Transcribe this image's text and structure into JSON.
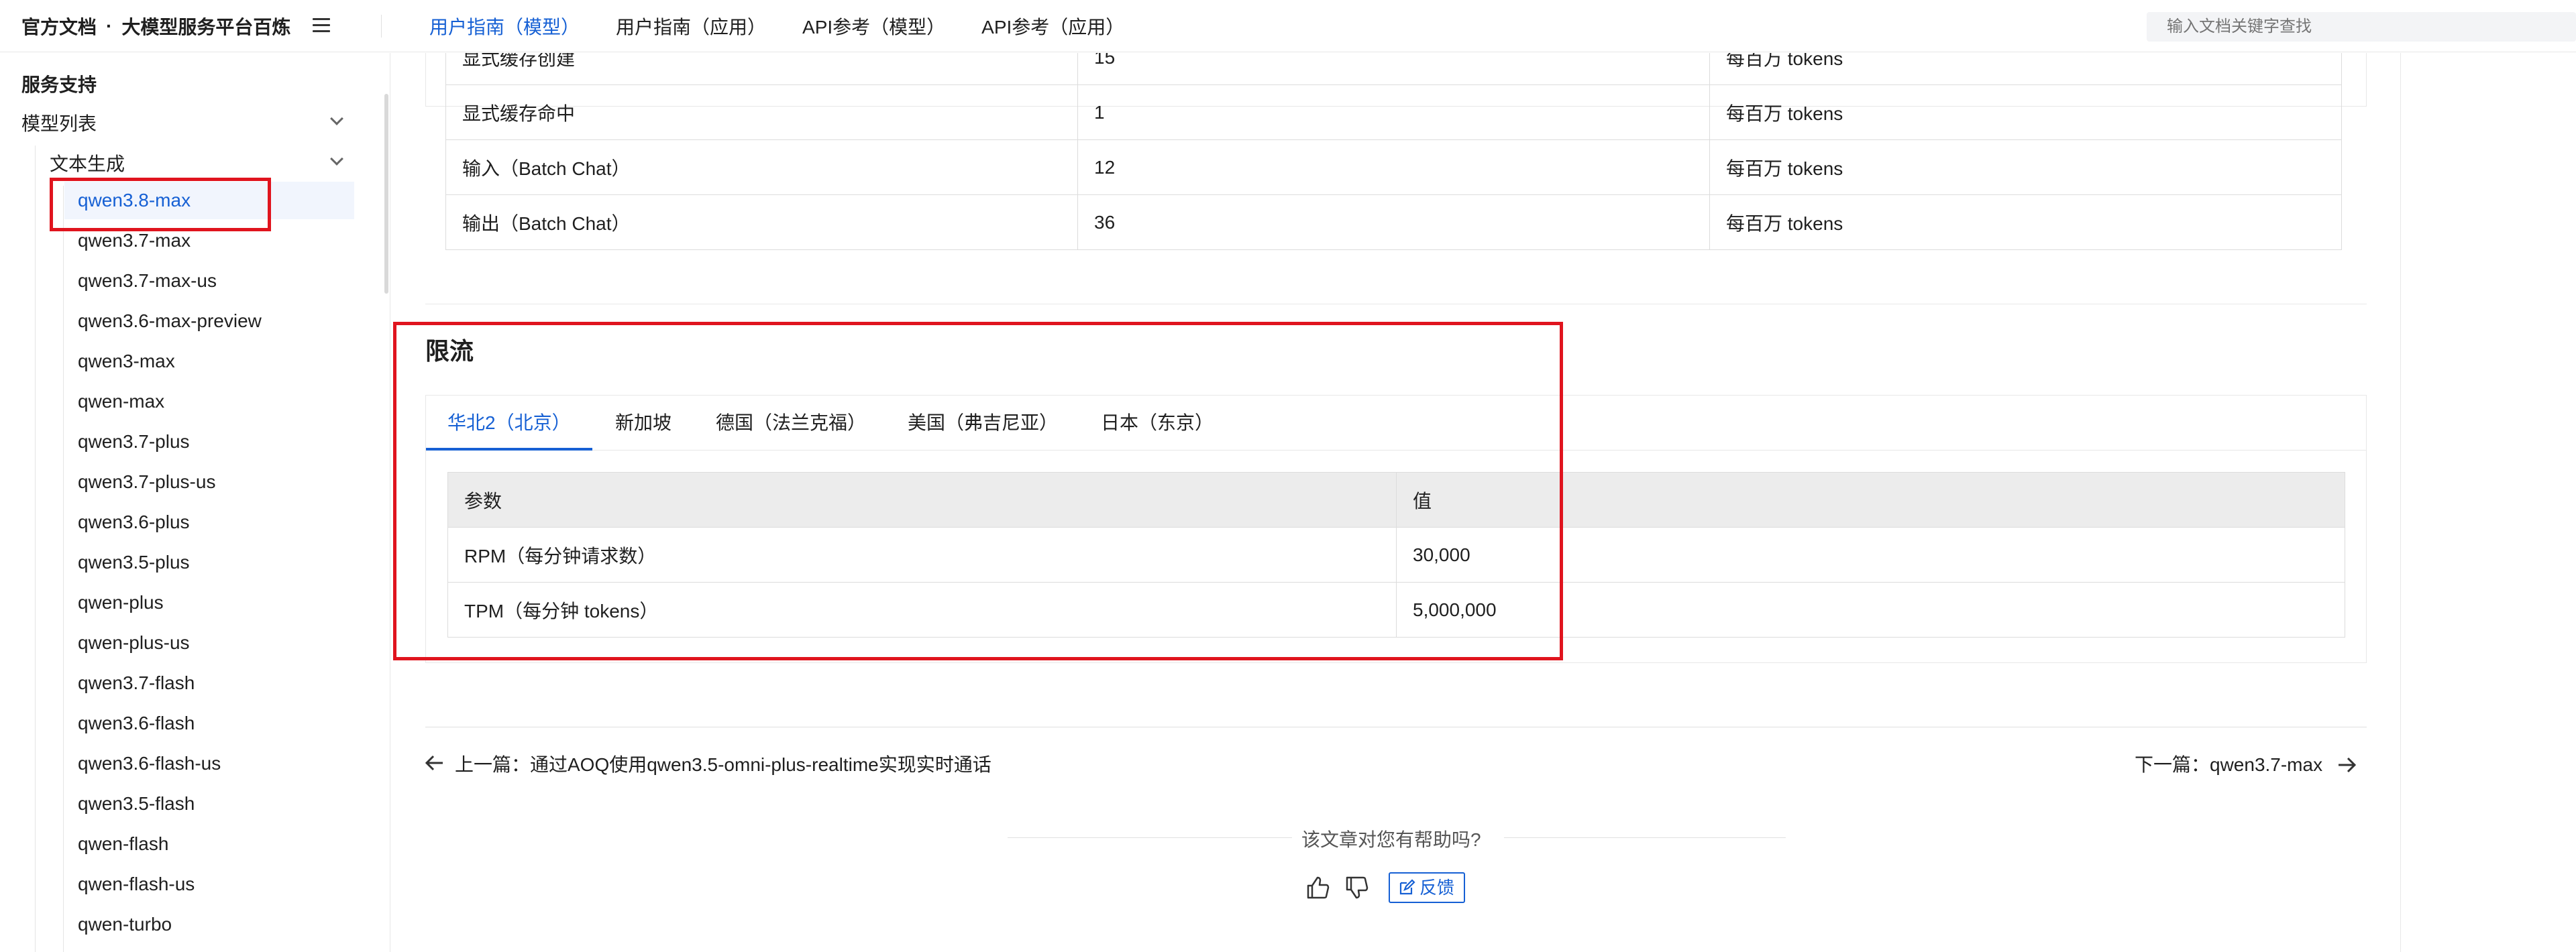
{
  "header": {
    "brand_left": "官方文档",
    "brand_dot": "·",
    "brand_right": "大模型服务平台百炼",
    "nav": [
      "用户指南（模型）",
      "用户指南（应用）",
      "API参考（模型）",
      "API参考（应用）"
    ],
    "search_placeholder": "输入文档关键字查找"
  },
  "sidebar": {
    "title": "服务支持",
    "group": "模型列表",
    "subgroup": "文本生成",
    "items": [
      "qwen3.8-max",
      "qwen3.7-max",
      "qwen3.7-max-us",
      "qwen3.6-max-preview",
      "qwen3-max",
      "qwen-max",
      "qwen3.7-plus",
      "qwen3.7-plus-us",
      "qwen3.6-plus",
      "qwen3.5-plus",
      "qwen-plus",
      "qwen-plus-us",
      "qwen3.7-flash",
      "qwen3.6-flash",
      "qwen3.6-flash-us",
      "qwen3.5-flash",
      "qwen-flash",
      "qwen-flash-us",
      "qwen-turbo"
    ]
  },
  "pricing": {
    "rows": [
      [
        "显式缓存创建",
        "15",
        "每百万 tokens"
      ],
      [
        "显式缓存命中",
        "1",
        "每百万 tokens"
      ],
      [
        "输入（Batch Chat）",
        "12",
        "每百万 tokens"
      ],
      [
        "输出（Batch Chat）",
        "36",
        "每百万 tokens"
      ]
    ]
  },
  "rate_limit": {
    "heading": "限流",
    "tabs": [
      "华北2（北京）",
      "新加坡",
      "德国（法兰克福）",
      "美国（弗吉尼亚）",
      "日本（东京）"
    ],
    "headers": [
      "参数",
      "值"
    ],
    "rows": [
      [
        "RPM（每分钟请求数）",
        "30,000"
      ],
      [
        "TPM（每分钟 tokens）",
        "5,000,000"
      ]
    ]
  },
  "pagination": {
    "prev": "上一篇：通过AOQ使用qwen3.5-omni-plus-realtime实现实时通话",
    "next": "下一篇：qwen3.7-max"
  },
  "feedback": {
    "question": "该文章对您有帮助吗?",
    "button": "反馈"
  },
  "colors": {
    "accent": "#1660d4",
    "highlight": "#e0141e"
  }
}
